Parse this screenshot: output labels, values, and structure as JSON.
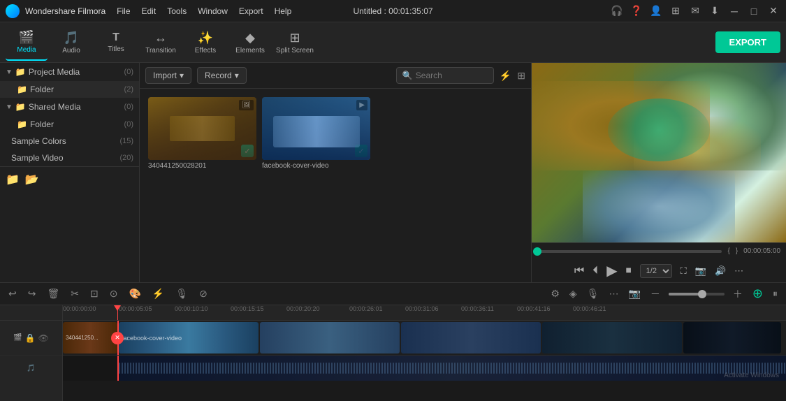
{
  "app": {
    "name": "Wondershare Filmora",
    "title": "Untitled : 00:01:35:07"
  },
  "menu": {
    "items": [
      "File",
      "Edit",
      "Tools",
      "Window",
      "Export",
      "Help"
    ]
  },
  "window_controls": [
    "─",
    "□",
    "✕"
  ],
  "toolbar": {
    "export_label": "EXPORT",
    "tools": [
      {
        "id": "media",
        "label": "Media",
        "icon": "🎬",
        "active": true
      },
      {
        "id": "audio",
        "label": "Audio",
        "icon": "🎵",
        "active": false
      },
      {
        "id": "titles",
        "label": "Titles",
        "icon": "T",
        "active": false
      },
      {
        "id": "transition",
        "label": "Transition",
        "icon": "↔",
        "active": false
      },
      {
        "id": "effects",
        "label": "Effects",
        "icon": "✨",
        "active": false
      },
      {
        "id": "elements",
        "label": "Elements",
        "icon": "◆",
        "active": false
      },
      {
        "id": "split_screen",
        "label": "Split Screen",
        "icon": "⊞",
        "active": false
      }
    ]
  },
  "sidebar": {
    "sections": [
      {
        "id": "project-media",
        "label": "Project Media",
        "count": "(0)",
        "expanded": true,
        "children": [
          {
            "id": "folder",
            "label": "Folder",
            "count": "(2)",
            "selected": true
          }
        ]
      },
      {
        "id": "shared-media",
        "label": "Shared Media",
        "count": "(0)",
        "expanded": true,
        "children": [
          {
            "id": "folder2",
            "label": "Folder",
            "count": "(0)",
            "selected": false
          }
        ]
      }
    ],
    "plain_items": [
      {
        "id": "sample-colors",
        "label": "Sample Colors",
        "count": "(15)",
        "selected": false
      },
      {
        "id": "sample-video",
        "label": "Sample Video",
        "count": "(20)",
        "selected": false
      }
    ],
    "footer_icons": [
      "📁",
      "📂"
    ]
  },
  "content": {
    "import_label": "Import",
    "record_label": "Record",
    "search_placeholder": "Search",
    "media_items": [
      {
        "id": "video1",
        "label": "340441250028201",
        "checked": true,
        "type": "video"
      },
      {
        "id": "video2",
        "label": "facebook-cover-video",
        "checked": true,
        "type": "video"
      }
    ]
  },
  "preview": {
    "time_display": "00:00:05:00",
    "progress_percent": 0,
    "speed": "1/2"
  },
  "timeline": {
    "ruler_times": [
      "00:00:00:00",
      "00:00:05:05",
      "00:00:10:10",
      "00:00:15:15",
      "00:00:20:20",
      "00:00:26:01",
      "00:00:31:06",
      "00:00:36:11",
      "00:00:41:16",
      "00:00:46:21"
    ],
    "playhead_time": "00:00:05:05",
    "clips": [
      {
        "label": "340441250028...",
        "track": 0
      },
      {
        "label": "facebook-cover-video",
        "track": 0
      }
    ],
    "zoom_percent": 60
  },
  "icons": {
    "undo": "↩",
    "redo": "↪",
    "delete": "🗑",
    "cut": "✂",
    "crop": "⊡",
    "stabilize": "⊙",
    "color": "🎨",
    "speed": "⚡",
    "split": "⊘",
    "settings": "⚙",
    "mark_in": "◈",
    "record_audio": "🎙",
    "more": "⋯",
    "snapshot": "📷",
    "volume": "🔊",
    "prev_frame": "⏮",
    "play_back": "⏴",
    "play": "▶",
    "stop": "⏹",
    "next_frame": "⏭",
    "fullscreen": "⛶",
    "zoom_in": "+",
    "zoom_out": "-",
    "add_track": "＋"
  }
}
